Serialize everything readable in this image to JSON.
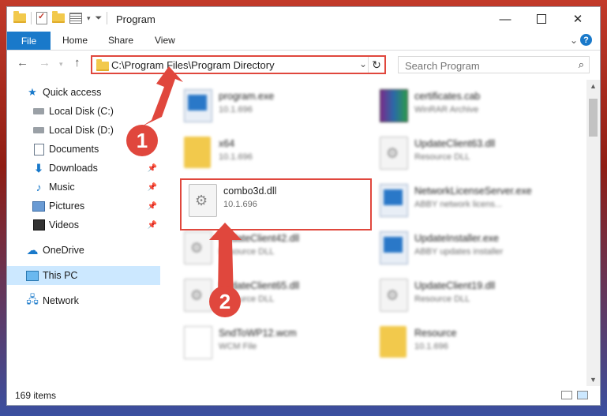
{
  "window": {
    "title": "Program",
    "minimize_icon": "minimize-icon",
    "maximize_icon": "maximize-icon",
    "close_icon": "close-icon"
  },
  "ribbon": {
    "tabs": [
      "File",
      "Home",
      "Share",
      "View"
    ]
  },
  "address": {
    "path": "C:\\Program Files\\Program Directory"
  },
  "search": {
    "placeholder": "Search Program"
  },
  "sidebar": {
    "items": [
      {
        "label": "Quick access",
        "icon": "star-icon"
      },
      {
        "label": "Local Disk (C:)",
        "icon": "drive-icon"
      },
      {
        "label": "Local Disk (D:)",
        "icon": "drive-icon"
      },
      {
        "label": "Documents",
        "icon": "documents-icon"
      },
      {
        "label": "Downloads",
        "icon": "downloads-icon",
        "pinned": true
      },
      {
        "label": "Music",
        "icon": "music-icon",
        "pinned": true
      },
      {
        "label": "Pictures",
        "icon": "pictures-icon",
        "pinned": true
      },
      {
        "label": "Videos",
        "icon": "videos-icon",
        "pinned": true
      },
      {
        "label": "OneDrive",
        "icon": "cloud-icon"
      },
      {
        "label": "This PC",
        "icon": "computer-icon",
        "selected": true
      },
      {
        "label": "Network",
        "icon": "network-icon"
      }
    ]
  },
  "files": [
    {
      "name": "program.exe",
      "sub": "10.1.696"
    },
    {
      "name": "certificates.cab",
      "sub": "WinRAR Archive"
    },
    {
      "name": "x64",
      "sub": "10.1.696"
    },
    {
      "name": "UpdateClient63.dll",
      "sub": "Resource DLL"
    },
    {
      "name": "combo3d.dll",
      "sub": "10.1.696"
    },
    {
      "name": "NetworkLicenseServer.exe",
      "sub": "ABBY network licens..."
    },
    {
      "name": "UpdateClient42.dll",
      "sub": "Resource DLL"
    },
    {
      "name": "UpdateInstaller.exe",
      "sub": "ABBY updates installer"
    },
    {
      "name": "UpdateClient65.dll",
      "sub": "Resource DLL"
    },
    {
      "name": "UpdateClient19.dll",
      "sub": "Resource DLL"
    },
    {
      "name": "SndToWP12.wcm",
      "sub": "WCM File"
    },
    {
      "name": "Resource",
      "sub": "10.1.696"
    }
  ],
  "status": {
    "count": "169 items"
  },
  "callouts": [
    "1",
    "2"
  ],
  "colors": {
    "accent": "#1979ca",
    "highlight": "#e0473d",
    "selected": "#cce8ff"
  }
}
